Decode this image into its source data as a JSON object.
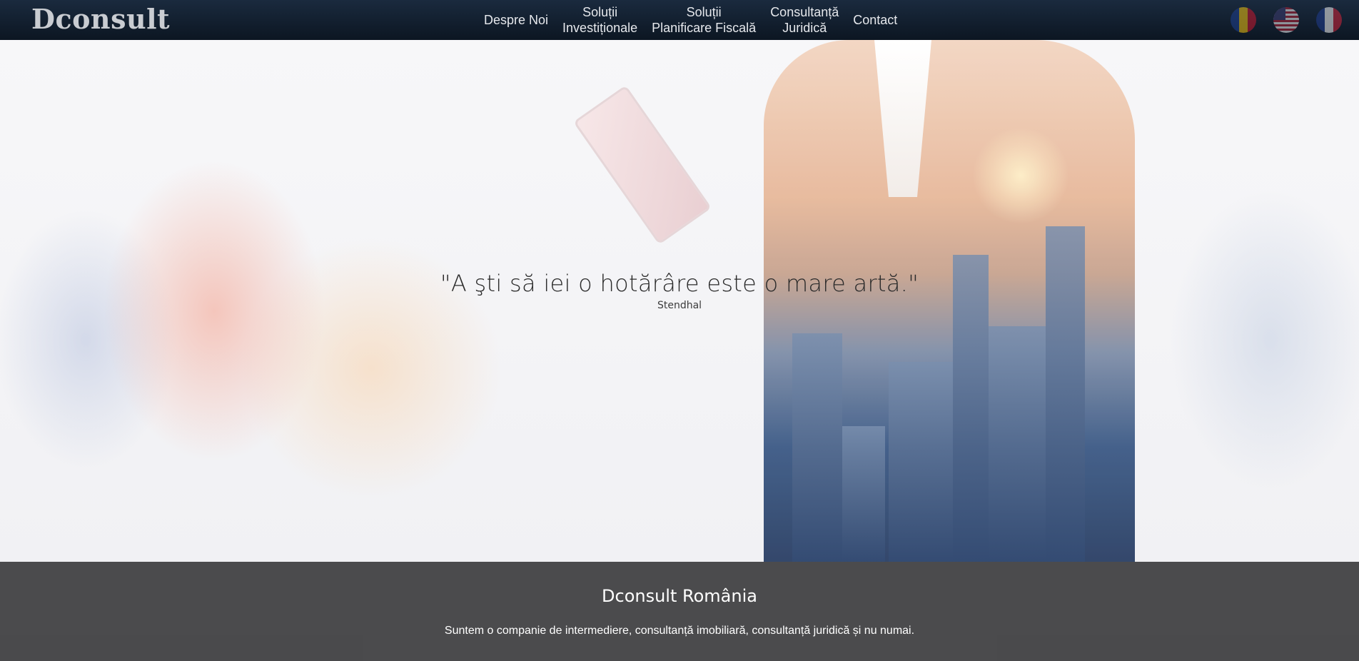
{
  "brand": {
    "logo_text": "Dconsult"
  },
  "nav": {
    "items": [
      {
        "label": "Despre Noi"
      },
      {
        "label": "Soluții\nInvestiționale"
      },
      {
        "label": "Soluții\nPlanificare Fiscală"
      },
      {
        "label": "Consultanță\nJuridică"
      },
      {
        "label": "Contact"
      }
    ]
  },
  "languages": [
    {
      "icon": "flag-romania-icon"
    },
    {
      "icon": "flag-usa-icon"
    },
    {
      "icon": "flag-france-icon"
    }
  ],
  "hero": {
    "quote": "\"A şti să iei o hotărâre este o mare artă.\"",
    "author": "Stendhal"
  },
  "info": {
    "title": "Dconsult România",
    "text": "Suntem o companie de intermediere, consultanță imobiliară, consultanță juridică și nu numai."
  },
  "colors": {
    "navbar": "#0c1622",
    "panel": "#3c3c3e"
  }
}
